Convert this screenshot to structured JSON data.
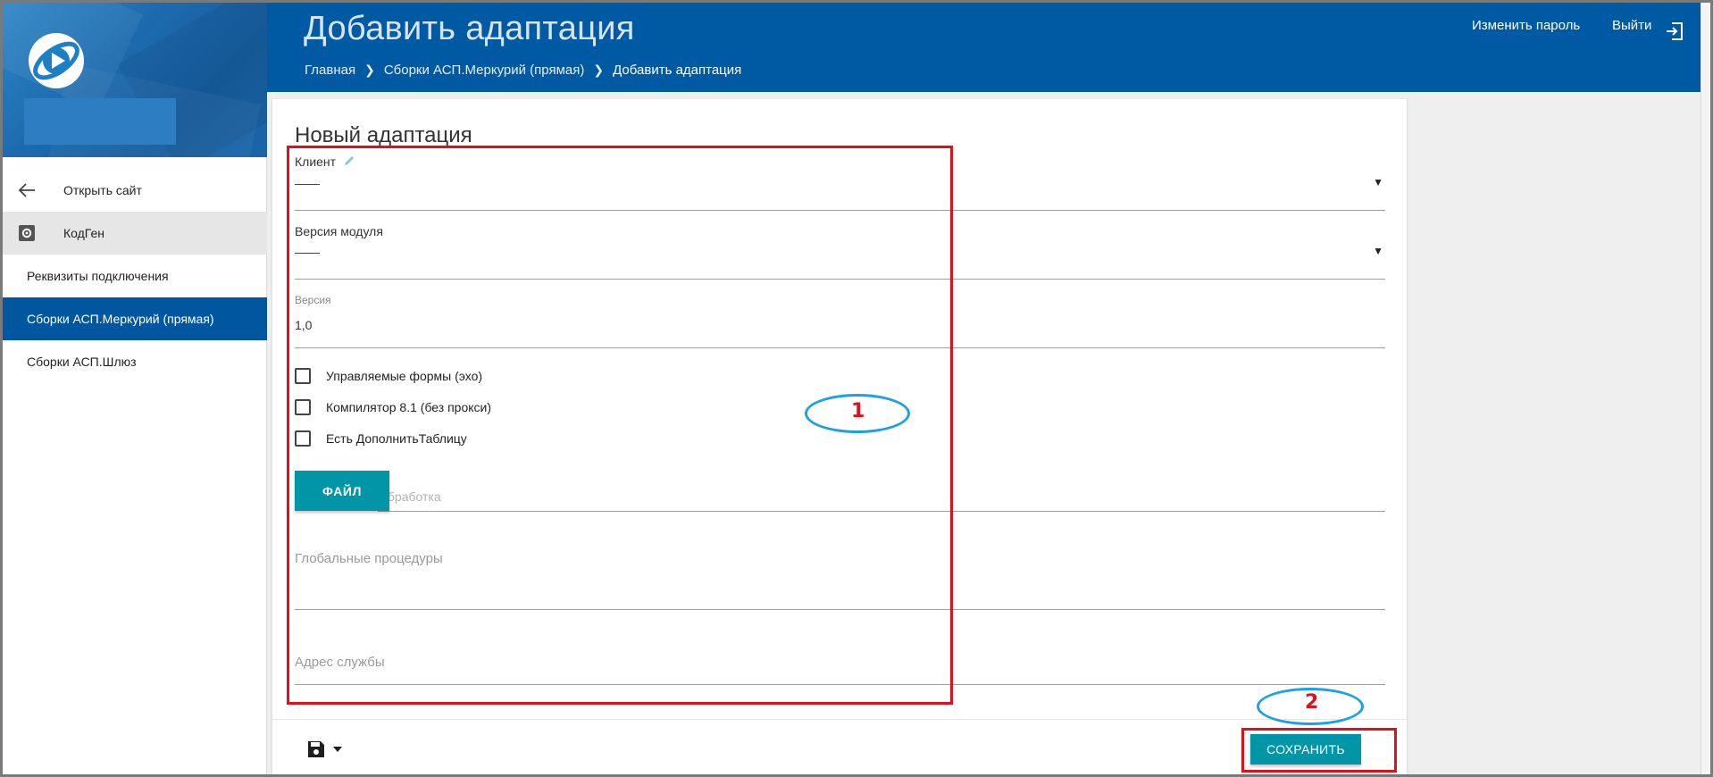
{
  "header": {
    "title": "Добавить адаптация",
    "breadcrumb": [
      "Главная",
      "Сборки АСП.Меркурий (прямая)",
      "Добавить адаптация"
    ],
    "change_password": "Изменить пароль",
    "logout": "Выйти"
  },
  "sidebar": {
    "items": [
      {
        "label": "Открыть сайт",
        "icon": "arrow-left-icon"
      },
      {
        "label": "КодГен",
        "icon": "settings-box-icon"
      },
      {
        "label": "Реквизиты подключения"
      },
      {
        "label": "Сборки АСП.Меркурий (прямая)",
        "active": true
      },
      {
        "label": "Сборки АСП.Шлюз"
      }
    ]
  },
  "form": {
    "title": "Новый адаптация",
    "client": {
      "label": "Клиент",
      "value": "——"
    },
    "module_version": {
      "label": "Версия модуля",
      "value": "——"
    },
    "version": {
      "label": "Версия",
      "value": "1,0"
    },
    "checkboxes": [
      {
        "label": "Управляемые формы (эхо)",
        "checked": false
      },
      {
        "label": "Компилятор 8.1 (без прокси)",
        "checked": false
      },
      {
        "label": "Есть ДополнитьТаблицу",
        "checked": false
      }
    ],
    "file_button": "ФАЙЛ",
    "file_placeholder": "Обработка",
    "global_procedures": {
      "label": "Глобальные процедуры"
    },
    "service_address": {
      "label": "Адрес службы"
    },
    "save_button": "СОХРАНИТЬ"
  },
  "annotations": {
    "marker_1": "1",
    "marker_2": "2"
  },
  "colors": {
    "header_blue": "#0059a3",
    "active_nav": "#0057a0",
    "teal_button": "#0096a8",
    "annotation_red": "#e0101c",
    "annotation_blue": "#1ea0e4"
  }
}
